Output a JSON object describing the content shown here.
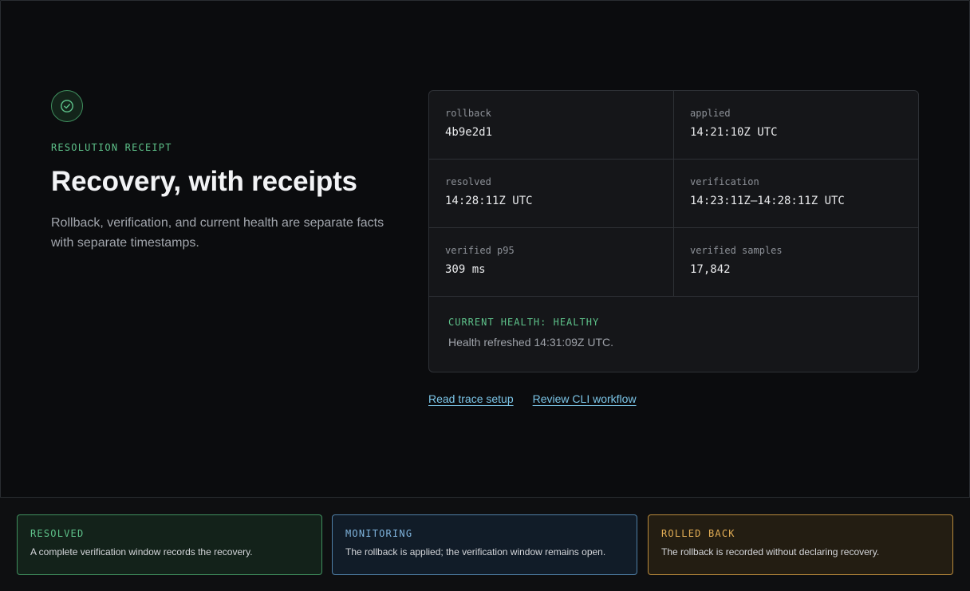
{
  "hero": {
    "eyebrow": "RESOLUTION RECEIPT",
    "title": "Recovery, with receipts",
    "subtitle": "Rollback, verification, and current health are separate facts with separate timestamps.",
    "icon": "check-circle-icon",
    "accent": "#5ec28a"
  },
  "receipt": {
    "fields": [
      {
        "label": "rollback",
        "value": "4b9e2d1"
      },
      {
        "label": "applied",
        "value": "14:21:10Z UTC"
      },
      {
        "label": "resolved",
        "value": "14:28:11Z UTC"
      },
      {
        "label": "verification",
        "value": "14:23:11Z–14:28:11Z UTC"
      },
      {
        "label": "verified p95",
        "value": "309 ms"
      },
      {
        "label": "verified samples",
        "value": "17,842"
      }
    ],
    "health_status": "CURRENT HEALTH: HEALTHY",
    "health_note": "Health refreshed 14:31:09Z UTC."
  },
  "links": {
    "trace_setup": "Read trace setup",
    "cli_workflow": "Review CLI workflow"
  },
  "states": [
    {
      "name": "RESOLVED",
      "description": "A complete verification window records the recovery.",
      "color": "#5ec28a"
    },
    {
      "name": "MONITORING",
      "description": "The rollback is applied; the verification window remains open.",
      "color": "#7fb3dc"
    },
    {
      "name": "ROLLED BACK",
      "description": "The rollback is recorded without declaring recovery.",
      "color": "#e2ad55"
    }
  ]
}
